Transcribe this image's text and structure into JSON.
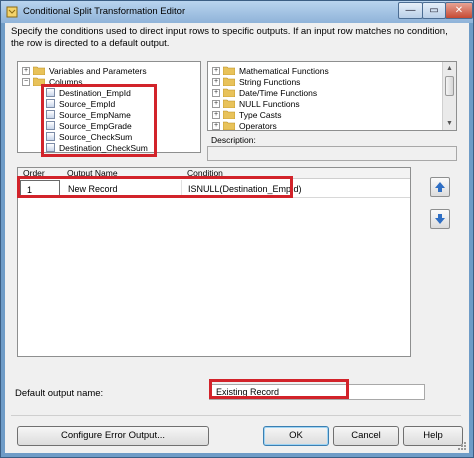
{
  "window": {
    "title": "Conditional Split Transformation Editor",
    "close_glyph": "✕",
    "max_glyph": "▭",
    "min_glyph": "—"
  },
  "instructions": "Specify the conditions used to direct input rows to specific outputs. If an input row matches no condition, the row is directed to a default output.",
  "left_tree": {
    "items": [
      {
        "label": "Variables and Parameters",
        "expander": "+",
        "icon": "folder-icon"
      },
      {
        "label": "Columns",
        "expander": "−",
        "icon": "folder-icon"
      }
    ],
    "columns": [
      "Destination_EmpId",
      "Source_EmpId",
      "Source_EmpName",
      "Source_EmpGrade",
      "Source_CheckSum",
      "Destination_CheckSum"
    ]
  },
  "right_tree": {
    "items": [
      {
        "label": "Mathematical Functions",
        "expander": "+"
      },
      {
        "label": "String Functions",
        "expander": "+"
      },
      {
        "label": "Date/Time Functions",
        "expander": "+"
      },
      {
        "label": "NULL Functions",
        "expander": "+"
      },
      {
        "label": "Type Casts",
        "expander": "+"
      },
      {
        "label": "Operators",
        "expander": "+"
      }
    ]
  },
  "description": {
    "label": "Description:",
    "value": ""
  },
  "grid": {
    "headers": {
      "order": "Order",
      "output_name": "Output Name",
      "condition": "Condition"
    },
    "rows": [
      {
        "order": "1",
        "output_name": "New Record",
        "condition": "ISNULL(Destination_EmpId)"
      }
    ]
  },
  "move_up_glyph": "▲",
  "move_down_glyph": "▼",
  "default_output": {
    "label": "Default output name:",
    "value": "Existing Record"
  },
  "buttons": {
    "configure": "Configure Error Output...",
    "ok": "OK",
    "cancel": "Cancel",
    "help": "Help"
  },
  "colors": {
    "highlight": "#d2232a",
    "arrow_blue": "#2f6fc4",
    "folder": "#e8c25a"
  }
}
